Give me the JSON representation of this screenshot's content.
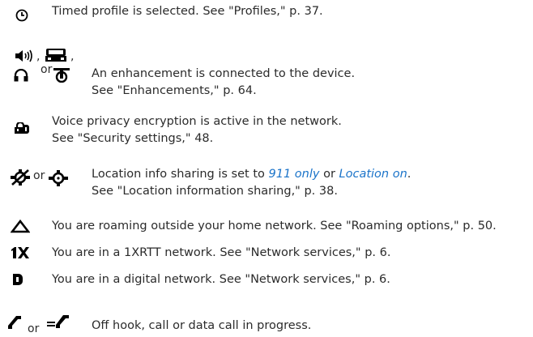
{
  "rows": [
    {
      "id": "timed",
      "lines": [
        "Timed profile is selected. See \"Profiles,\" p. 37."
      ]
    },
    {
      "id": "enhancement",
      "separator": "or",
      "lines": [
        "An enhancement is connected to the device.",
        "See \"Enhancements,\" p. 64."
      ]
    },
    {
      "id": "voice-privacy",
      "lines": [
        "Voice privacy encryption is active in the network.",
        "See \"Security settings,\" 48."
      ]
    },
    {
      "id": "location",
      "separator": "or",
      "line1_prefix": "Location info sharing is set to ",
      "line1_link1": "911 only",
      "line1_or": " or ",
      "line1_link2": "Location on",
      "line1_suffix": ".",
      "lines": [
        "See \"Location information sharing,\" p. 38."
      ]
    },
    {
      "id": "roaming",
      "lines": [
        "You are roaming outside your home network. See \"Roaming options,\" p. 50."
      ]
    },
    {
      "id": "1xrtt",
      "lines": [
        "You are in a 1XRTT network. See \"Network services,\" p. 6."
      ]
    },
    {
      "id": "digital",
      "lines": [
        "You are in a digital network. See \"Network services,\" p. 6."
      ]
    },
    {
      "id": "off-hook",
      "separator": "or",
      "lines": [
        "Off hook, call or data call in progress."
      ]
    }
  ],
  "colors": {
    "text": "#2b2b2b",
    "link": "#1a73c9",
    "icon": "#000000"
  }
}
